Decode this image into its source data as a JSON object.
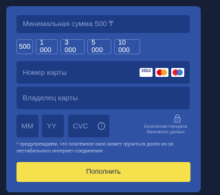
{
  "form": {
    "amount_placeholder": "Минимальная сумма 500 ₸",
    "quick_amounts": [
      "500",
      "1 000",
      "3 000",
      "5 000",
      "10 000"
    ],
    "card_number_placeholder": "Номер карты",
    "card_brands": [
      "visa-logo",
      "mastercard-logo",
      "maestro-logo"
    ],
    "card_brand_visa_text": "VISA",
    "holder_placeholder": "Владелец карты",
    "month_placeholder": "MM",
    "year_placeholder": "YY",
    "cvc_placeholder": "CVC",
    "secure_text": "Безопасная передача банковских данных",
    "note": "* предупреждаем, что платежное окно может грузиться долго из-за нестабильного интернет-соединения",
    "submit_label": "Пополнить"
  },
  "colors": {
    "background": "#161f36",
    "card": "#2f52a4",
    "field": "#1d3b83",
    "accent_button": "#f6e14c"
  }
}
